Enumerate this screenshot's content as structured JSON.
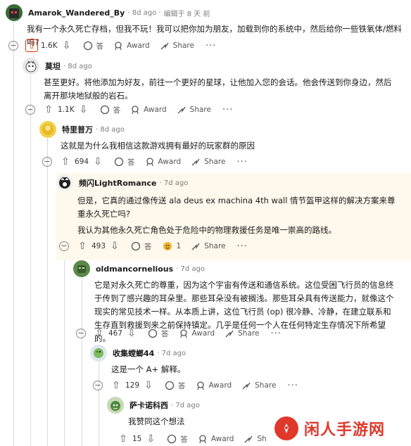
{
  "comments": [
    {
      "username": "Amarok_Wandered_By",
      "time": "· 8d ago ·",
      "edited": "编辑于 8 天 前",
      "text": "我有一个永久死亡存档，但我不玩！我可以把你加为朋友，加载到你的系统中，然后给你一些铁氧体/燃料吗?",
      "score": "1.6K",
      "reply_label": "答",
      "award_label": "Award",
      "share_label": "Share",
      "more_label": "···"
    },
    {
      "username": "莫坦",
      "time": "· 8d ago",
      "text": "甚至更好。将他添加为好友，前往一个更好的星球，让他加入您的会话。他会传送到你身边，然后离开那块地狱般的岩石。",
      "score": "1.1K",
      "reply_label": "答",
      "award_label": "Award",
      "share_label": "Share",
      "more_label": "···"
    },
    {
      "username": "特里普万",
      "time": "· 8d ago",
      "text": "这就是为什么我相信这款游戏拥有最好的玩家群的原因",
      "score": "694",
      "reply_label": "答",
      "award_label": "Award",
      "share_label": "Share",
      "more_label": "···"
    },
    {
      "username": "频闪LightRomance",
      "time": "· 7d ago",
      "text": "但是，它真的通过像传送 ala deus ex machina 4th wall 情节盔甲这样的解决方案来尊重永久死亡吗?",
      "text2": "我认为其他永久死亡角色处于危险中的物理救援任务是唯一崇高的路线。",
      "score": "493",
      "reply_label": "答",
      "award_count": "1",
      "share_label": "Share",
      "more_label": "···"
    },
    {
      "username": "oldmancornelious",
      "time": "· 7d ago",
      "text": "它是对永久死亡的尊重，因为这个宇宙有传送和通信系统。这位受困飞行员的信息终于传到了感兴趣的耳朵里。那些耳朵没有被搁浅。那些耳朵具有传送能力，就像这个现实的常见技术一样。从本质上讲，这位飞行员 (op) 很冷静、冷静，在建立联系和生存直到救援到来之前保持镇定。几乎是任何一个人在任何特定生存情况下所希望的。",
      "score": "467",
      "reply_label": "答",
      "award_label": "Award",
      "share_label": "Share",
      "more_label": "···"
    },
    {
      "username": "收集螳螂44",
      "time": "· 7d ago",
      "text": "这是一个 A+ 解释。",
      "score": "129",
      "reply_label": "答",
      "award_label": "Award",
      "share_label": "Share",
      "more_label": "···"
    },
    {
      "username": "萨卡诺科西",
      "time": "· 7d ago",
      "text": "我赞同这个想法",
      "score": "15",
      "reply_label": "答",
      "award_label": "Award",
      "share_label": "Sh"
    }
  ],
  "watermark": {
    "text": "闲人手游网"
  },
  "colors": {
    "upvote_active": "#d93a00",
    "highlight_bg": "#fff8ec",
    "watermark": "#e0382b"
  }
}
